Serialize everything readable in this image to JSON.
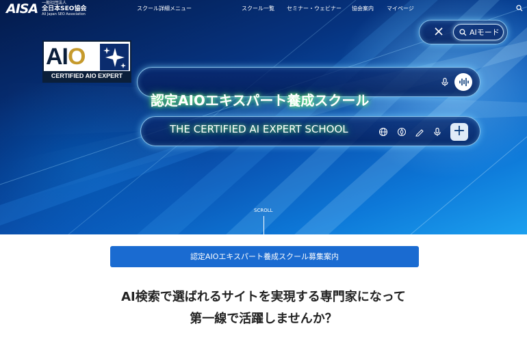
{
  "header": {
    "logo_mark": "AISA",
    "logo_line1": "一般社団法人",
    "logo_line2": "全日本SEO協会",
    "logo_line3": "All Japan SEO Association",
    "nav": [
      {
        "label": "スクール詳細メニュー"
      },
      {
        "label": "スクール一覧"
      },
      {
        "label": "セミナー・ウェビナー"
      },
      {
        "label": "協会案内"
      },
      {
        "label": "マイページ"
      }
    ],
    "search_icon": "search-icon"
  },
  "badge": {
    "aio_a": "AI",
    "aio_o": "O",
    "caption": "CERTIFIED AIO EXPERT",
    "icon": "sparkle-icon"
  },
  "hero": {
    "title": "認定AIOエキスパート養成スクール",
    "subtitle": "THE CERTIFIED AI EXPERT SCHOOL",
    "ai_mode_label": "AIモード",
    "plus": "+",
    "scroll": "SCROLL"
  },
  "cta": {
    "label": "認定AIOエキスパート養成スクール募集案内"
  },
  "lead": {
    "line1": "AI検索で選ばれるサイトを実現する専門家になって",
    "line2": "第一線で活躍しませんか？"
  },
  "colors": {
    "cta_bg": "#1a6bd1",
    "hero_dark": "#041a4a",
    "hero_light": "#1ca0ef",
    "title_glow": "#50dc50"
  }
}
